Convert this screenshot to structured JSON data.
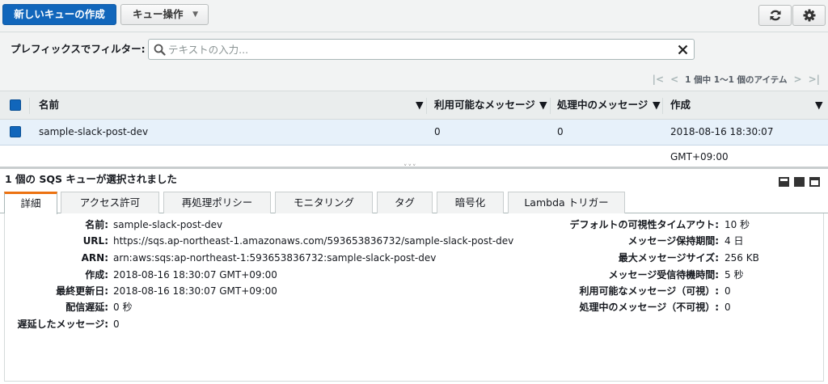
{
  "toolbar": {
    "create_label": "新しいキューの作成",
    "actions_label": "キュー操作",
    "refresh_icon": "refresh-icon",
    "settings_icon": "gear-icon"
  },
  "filter": {
    "label": "プレフィックスでフィルター:",
    "placeholder": "テキストの入力..."
  },
  "pagination": {
    "text": "1 個中 1～1 個のアイテム"
  },
  "table": {
    "columns": [
      "名前",
      "利用可能なメッセージ",
      "処理中のメッセージ",
      "作成"
    ],
    "rows": [
      {
        "name": "sample-slack-post-dev",
        "available": "0",
        "in_flight": "0",
        "created": "2018-08-16 18:30:07 GMT+09:00"
      }
    ]
  },
  "selection": {
    "title": "1 個の SQS キューが選択されました"
  },
  "tabs": [
    "詳細",
    "アクセス許可",
    "再処理ポリシー",
    "モニタリング",
    "タグ",
    "暗号化",
    "Lambda トリガー"
  ],
  "details": {
    "left": [
      {
        "key": "名前:",
        "value": "sample-slack-post-dev"
      },
      {
        "key": "URL:",
        "value": "https://sqs.ap-northeast-1.amazonaws.com/593653836732/sample-slack-post-dev"
      },
      {
        "key": "ARN:",
        "value": "arn:aws:sqs:ap-northeast-1:593653836732:sample-slack-post-dev"
      },
      {
        "key": "作成:",
        "value": "2018-08-16 18:30:07 GMT+09:00"
      },
      {
        "key": "最終更新日:",
        "value": "2018-08-16 18:30:07 GMT+09:00"
      },
      {
        "key": "配信遅延:",
        "value": "0 秒"
      },
      {
        "key": "遅延したメッセージ:",
        "value": "0"
      }
    ],
    "right": [
      {
        "key": "デフォルトの可視性タイムアウト:",
        "value": "10 秒"
      },
      {
        "key": "メッセージ保持期間:",
        "value": "4 日"
      },
      {
        "key": "最大メッセージサイズ:",
        "value": "256 KB"
      },
      {
        "key": "メッセージ受信待機時間:",
        "value": "5 秒"
      },
      {
        "key": "利用可能なメッセージ（可視）:",
        "value": "0"
      },
      {
        "key": "処理中のメッセージ（不可視）:",
        "value": "0"
      }
    ]
  },
  "colors": {
    "primary": "#1166bb",
    "active_tab": "#ec7211",
    "selected_row": "#e7f1fa"
  }
}
